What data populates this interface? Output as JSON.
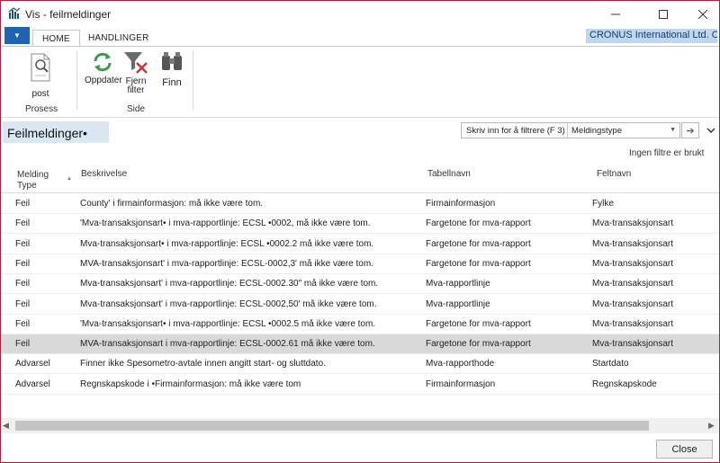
{
  "window": {
    "title": "Vis - feilmeldinger"
  },
  "ribbon": {
    "tabs": [
      "HOME",
      "HANDLINGER"
    ],
    "company": "CRONUS International Ltd. O",
    "groups": [
      {
        "label": "Prosess",
        "buttons": [
          {
            "label": "post",
            "icon": "post-document-icon"
          }
        ]
      },
      {
        "label": "Side",
        "buttons": [
          {
            "label": "Oppdater",
            "icon": "refresh-icon"
          },
          {
            "label": "Fjern filter",
            "icon": "clear-filter-icon"
          },
          {
            "label": "Finn",
            "icon": "binoculars-icon"
          }
        ]
      }
    ]
  },
  "page": {
    "title": "Feilmeldinger•",
    "filter_placeholder": "Skriv inn for å filtrere (F 3)",
    "filter_field": "Meldingstype",
    "no_filters": "Ingen filtre er brukt"
  },
  "table": {
    "columns": [
      "Melding Type",
      "Beskrivelse",
      "Tabellnavn",
      "Feltnavn"
    ],
    "rows": [
      {
        "type": "Feil",
        "description": "County' i firmainformasjon: må ikke være tom.",
        "table": "Firmainformasjon",
        "field": "Fylke"
      },
      {
        "type": "Feil",
        "description": "'Mva-transaksjonsart• i mva-rapportlinje: ECSL •0002, må ikke være tom.",
        "table": "Fargetone for mva-rapport",
        "field": "Mva-transaksjonsart"
      },
      {
        "type": "Feil",
        "description": "Mva-transaksjonsart• i mva-rapportlinje: ECSL •0002.2 må ikke være tom.",
        "table": "Fargetone for mva-rapport",
        "field": "Mva-transaksjonsart"
      },
      {
        "type": "Feil",
        "description": "MVA-transaksjonsart' i mva-rapportlinje: ECSL-0002,3' må ikke være tom.",
        "table": "Fargetone for mva-rapport",
        "field": "Mva-transaksjonsart"
      },
      {
        "type": "Feil",
        "description": "Mva-transaksjonsart' i mva-rapportlinje: ECSL-0002.30\" må ikke være tom.",
        "table": "Mva-rapportlinje",
        "field": "Mva-transaksjonsart"
      },
      {
        "type": "Feil",
        "description": "Mva-transaksjonsart' i mva-rapportlinje: ECSL-0002,50' må ikke være tom.",
        "table": "Mva-rapportlinje",
        "field": "Mva-transaksjonsart"
      },
      {
        "type": "Feil",
        "description": "'Mva-transaksjonsart• i mva-rapportlinje: ECSL •0002.5 må ikke være tom.",
        "table": "Fargetone for mva-rapport",
        "field": "Mva-transaksjonsart"
      },
      {
        "type": "Feil",
        "description": "MVA-transaksjonsart i mva-rapportlinje: ECSL-0002.61 må ikke være tom.",
        "table": "Fargetone for mva-rapport",
        "field": "Mva-transaksjonsart",
        "selected": true
      },
      {
        "type": "Advarsel",
        "description": "Finner ikke Spesometro-avtale innen angitt start- og sluttdato.",
        "table": "Mva-rapporthode",
        "field": "Startdato"
      },
      {
        "type": "Advarsel",
        "description": "Regnskapskode i •Firmainformasjon: må ikke være tom",
        "table": "Firmainformasjon",
        "field": "Regnskapskode"
      }
    ]
  },
  "footer": {
    "close_label": "Close"
  },
  "colors": {
    "accent": "#1f63b5",
    "company_bg": "#bed6ee",
    "selected_row": "#d9d9d9",
    "window_border": "#b81c3a"
  }
}
